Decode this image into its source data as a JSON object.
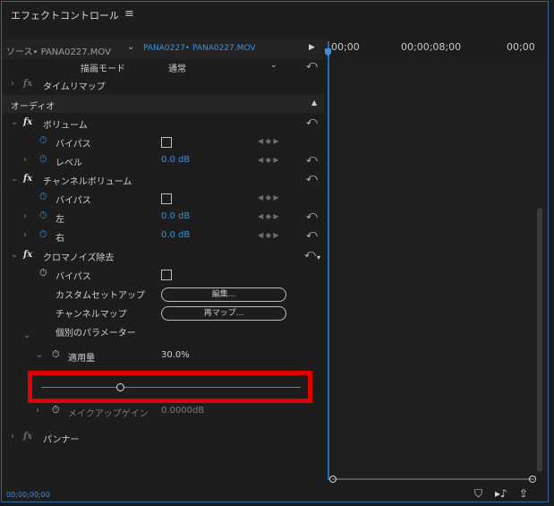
{
  "panel": {
    "title": "エフェクトコントロール",
    "menu_icon": "hamburger-menu-icon"
  },
  "header": {
    "source_clip": "ソース• PANA0227.MOV",
    "sequence_clip": "PANA0227• PANA0227.MOV",
    "timecodes": [
      "00;00",
      "00;00;08;00",
      "00;00"
    ]
  },
  "rows": {
    "draw_mode": {
      "label": "描画モード",
      "value": "通常"
    },
    "time_remap": {
      "label": "タイムリマップ"
    },
    "audio_section": {
      "label": "オーディオ"
    },
    "volume": {
      "label": "ボリューム",
      "bypass": "バイパス",
      "level": "レベル",
      "level_value": "0.0",
      "unit": "dB"
    },
    "channel_volume": {
      "label": "チャンネルボリューム",
      "bypass": "バイパス",
      "left": "左",
      "left_value": "0.0",
      "right": "右",
      "right_value": "0.0",
      "unit": "dB"
    },
    "chroma_denoise": {
      "label": "クロマノイズ除去",
      "bypass": "バイパス",
      "custom_setup": "カスタムセットアップ",
      "edit_button": "編集...",
      "channel_map": "チャンネルマップ",
      "remap_button": "再マップ...",
      "individual_params": "個別のパラメーター",
      "amount_label": "適用量",
      "amount_value": "30.0%",
      "amount_fraction": 0.3,
      "makeup_gain_label": "メイクアップゲイン",
      "makeup_gain_value": "0.0000dB"
    },
    "panner": {
      "label": "パンナー"
    }
  },
  "footer": {
    "timecode": "00;00;00;00"
  },
  "colors": {
    "accent": "#3f8fdc",
    "highlight": "#e00000",
    "panel_border": "#2c6aa8"
  }
}
